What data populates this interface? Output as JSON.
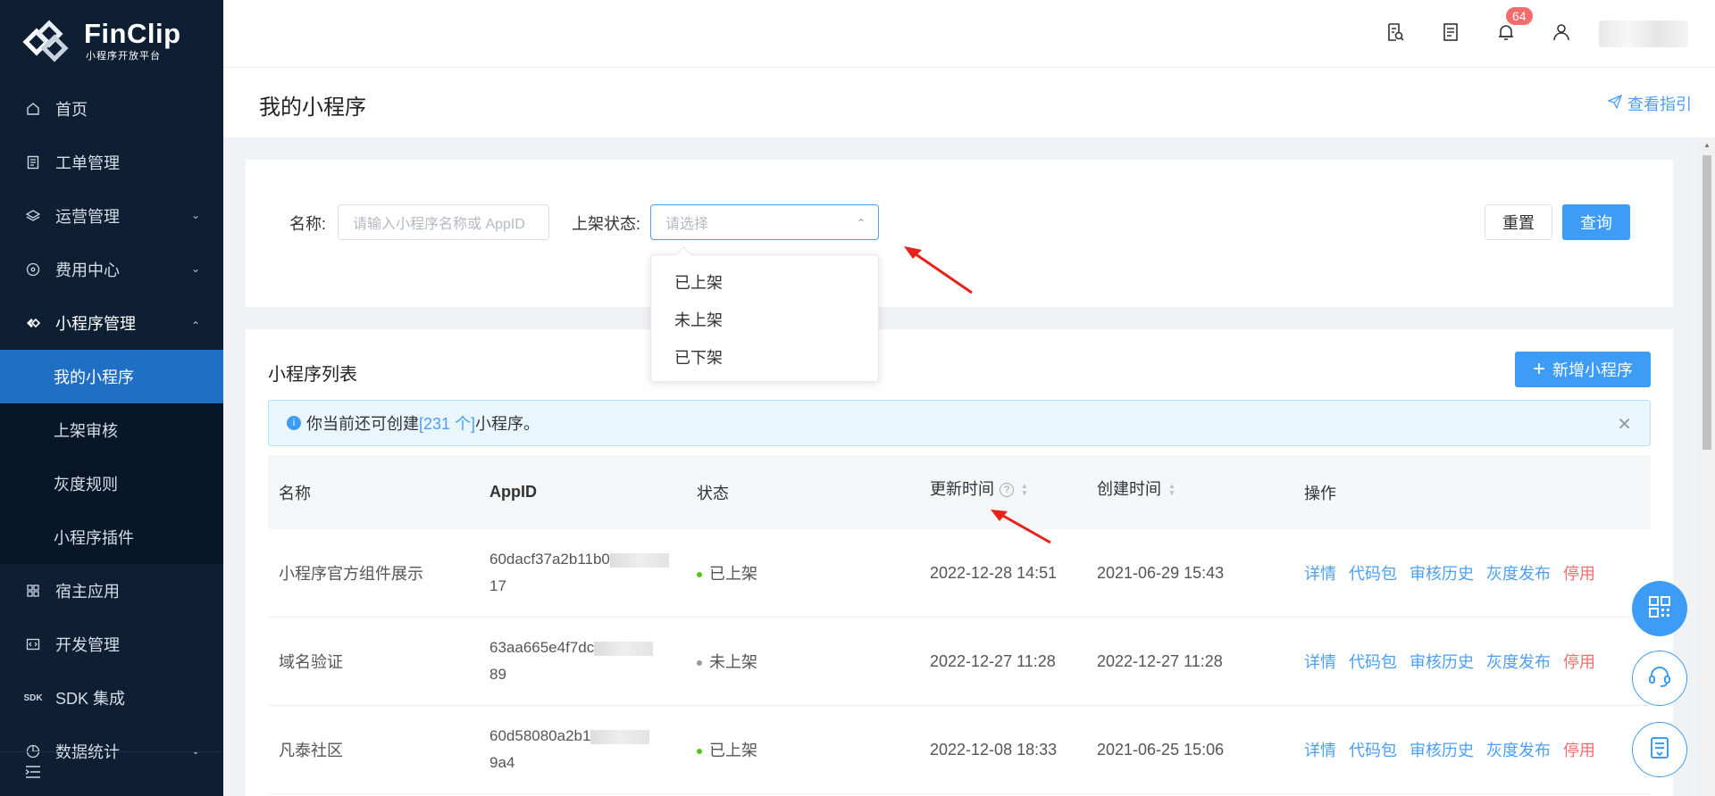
{
  "brand": {
    "name": "FinClip",
    "subtitle": "小程序开放平台"
  },
  "sidebar": {
    "items": [
      {
        "label": "首页",
        "icon": "home-icon"
      },
      {
        "label": "工单管理",
        "icon": "ticket-icon"
      },
      {
        "label": "运营管理",
        "icon": "layers-icon"
      },
      {
        "label": "费用中心",
        "icon": "billing-icon"
      },
      {
        "label": "小程序管理",
        "icon": "miniprogram-icon"
      },
      {
        "label": "宿主应用",
        "icon": "grid-icon"
      },
      {
        "label": "开发管理",
        "icon": "code-icon"
      },
      {
        "label": "SDK 集成",
        "icon": "sdk-icon"
      },
      {
        "label": "数据统计",
        "icon": "chart-icon"
      }
    ],
    "subitems": [
      {
        "label": "我的小程序"
      },
      {
        "label": "上架审核"
      },
      {
        "label": "灰度规则"
      },
      {
        "label": "小程序插件"
      }
    ]
  },
  "header": {
    "notification_count": "64"
  },
  "page": {
    "title": "我的小程序",
    "guide_link": "查看指引"
  },
  "filter": {
    "name_label": "名称:",
    "name_placeholder": "请输入小程序名称或 AppID",
    "status_label": "上架状态:",
    "status_placeholder": "请选择",
    "reset_label": "重置",
    "query_label": "查询",
    "options": [
      "已上架",
      "未上架",
      "已下架"
    ]
  },
  "list": {
    "title": "小程序列表",
    "add_label": "新增小程序",
    "alert_prefix": "你当前还可创建",
    "alert_count": "[231 个]",
    "alert_suffix": "小程序。",
    "columns": {
      "name": "名称",
      "appid": "AppID",
      "status": "状态",
      "updated": "更新时间",
      "created": "创建时间",
      "actions": "操作"
    },
    "action_labels": {
      "detail": "详情",
      "code": "代码包",
      "history": "审核历史",
      "gray": "灰度发布",
      "disable": "停用"
    },
    "rows": [
      {
        "name": "小程序官方组件展示",
        "appid_line1": "60dacf37a2b11b0",
        "appid_line2": "17",
        "status": "已上架",
        "status_color": "#52c41a",
        "updated": "2022-12-28 14:51",
        "created": "2021-06-29 15:43"
      },
      {
        "name": "域名验证",
        "appid_line1": "63aa665e4f7dc",
        "appid_line2": "89",
        "status": "未上架",
        "status_color": "#999999",
        "updated": "2022-12-27 11:28",
        "created": "2022-12-27 11:28"
      },
      {
        "name": "凡泰社区",
        "appid_line1": "60d58080a2b1",
        "appid_line2": "9a4",
        "status": "已上架",
        "status_color": "#52c41a",
        "updated": "2022-12-08 18:33",
        "created": "2021-06-25 15:06"
      }
    ]
  },
  "colors": {
    "primary": "#3d9cf5",
    "sidebar_bg": "#0e1f33",
    "danger": "#f56c6c"
  }
}
